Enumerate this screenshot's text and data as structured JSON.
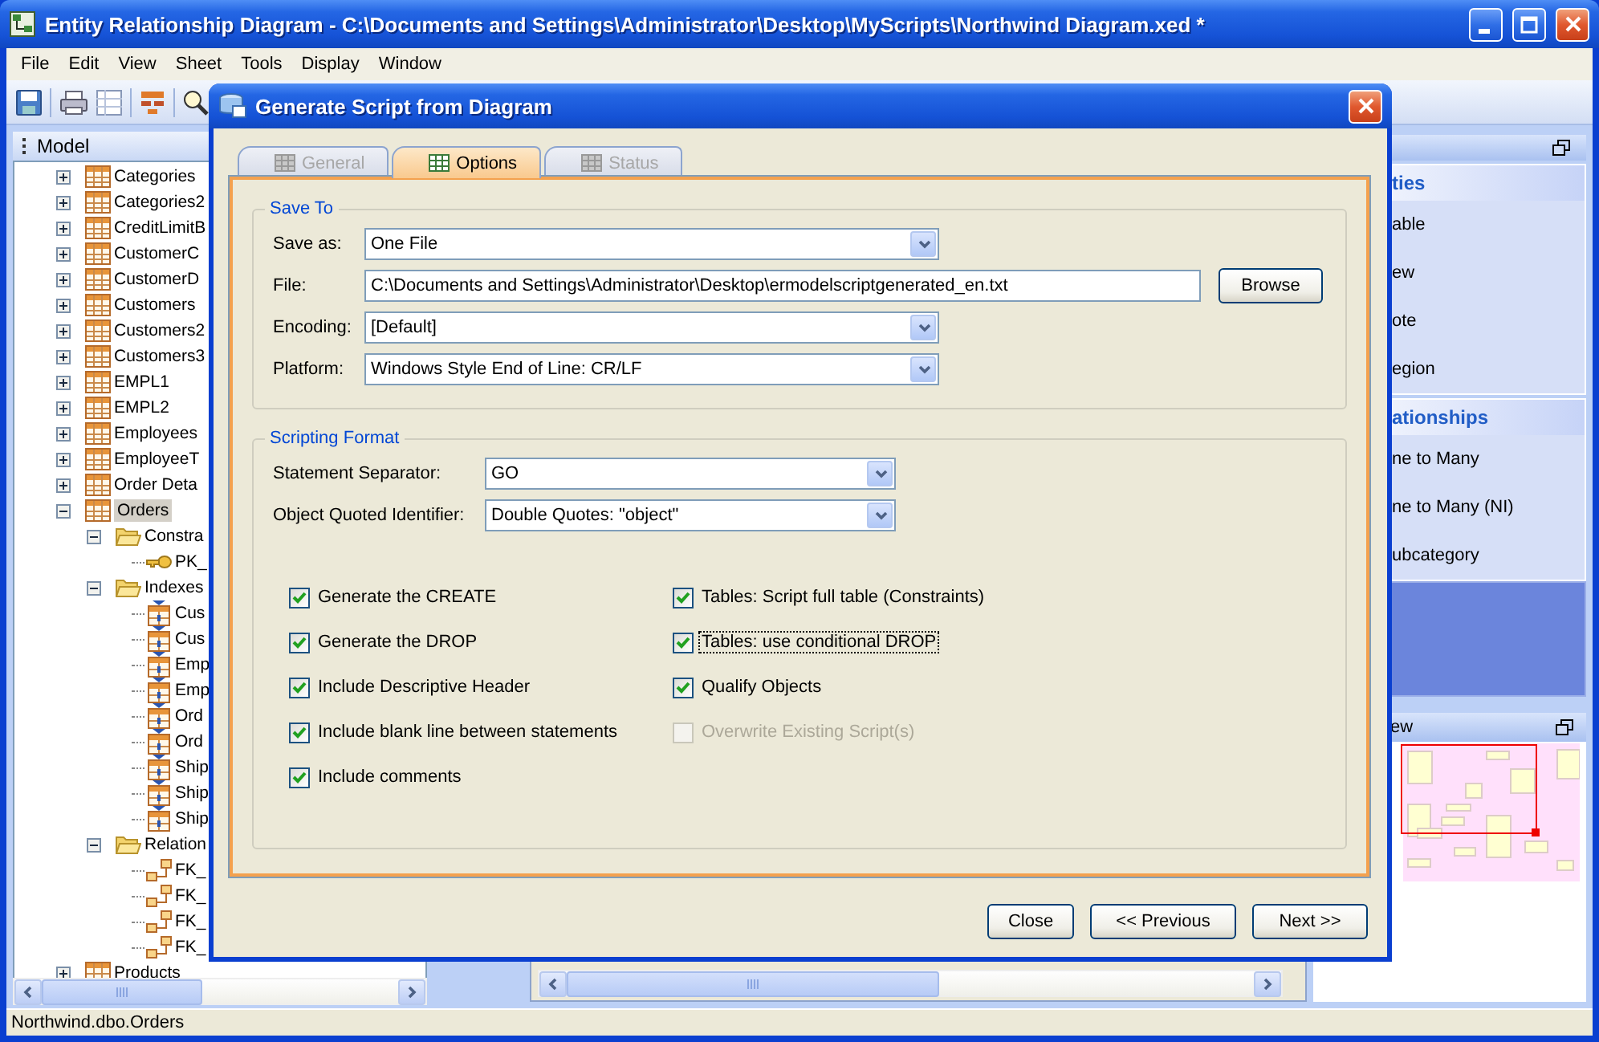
{
  "window": {
    "title": "Entity Relationship Diagram - C:\\Documents and Settings\\Administrator\\Desktop\\MyScripts\\Northwind Diagram.xed *"
  },
  "menu": [
    "File",
    "Edit",
    "View",
    "Sheet",
    "Tools",
    "Display",
    "Window"
  ],
  "model": {
    "title": "Model",
    "tree": [
      {
        "label": "Categories",
        "kind": "table",
        "expanded": false,
        "selected": false
      },
      {
        "label": "Categories2",
        "kind": "table",
        "expanded": false,
        "selected": false
      },
      {
        "label": "CreditLimitB",
        "kind": "table",
        "expanded": false,
        "selected": false
      },
      {
        "label": "CustomerC",
        "kind": "table",
        "expanded": false,
        "selected": false
      },
      {
        "label": "CustomerD",
        "kind": "table",
        "expanded": false,
        "selected": false
      },
      {
        "label": "Customers",
        "kind": "table",
        "expanded": false,
        "selected": false
      },
      {
        "label": "Customers2",
        "kind": "table",
        "expanded": false,
        "selected": false
      },
      {
        "label": "Customers3",
        "kind": "table",
        "expanded": false,
        "selected": false
      },
      {
        "label": "EMPL1",
        "kind": "table",
        "expanded": false,
        "selected": false
      },
      {
        "label": "EMPL2",
        "kind": "table",
        "expanded": false,
        "selected": false
      },
      {
        "label": "Employees",
        "kind": "table",
        "expanded": false,
        "selected": false
      },
      {
        "label": "EmployeeT",
        "kind": "table",
        "expanded": false,
        "selected": false
      },
      {
        "label": "Order Deta",
        "kind": "table",
        "expanded": false,
        "selected": false
      },
      {
        "label": "Orders",
        "kind": "table",
        "expanded": true,
        "selected": true,
        "children": [
          {
            "label": "Constra",
            "kind": "folder",
            "expanded": true,
            "selected": false,
            "children": [
              {
                "label": "PK_",
                "kind": "key",
                "selected": false
              }
            ]
          },
          {
            "label": "Indexes",
            "kind": "folder",
            "expanded": true,
            "selected": false,
            "children": [
              {
                "label": "Cus",
                "kind": "index",
                "selected": false
              },
              {
                "label": "Cus",
                "kind": "index",
                "selected": false
              },
              {
                "label": "Emp",
                "kind": "index",
                "selected": false
              },
              {
                "label": "Emp",
                "kind": "index",
                "selected": false
              },
              {
                "label": "Ord",
                "kind": "index",
                "selected": false
              },
              {
                "label": "Ord",
                "kind": "index",
                "selected": false
              },
              {
                "label": "Ship",
                "kind": "index",
                "selected": false
              },
              {
                "label": "Ship",
                "kind": "index",
                "selected": false
              },
              {
                "label": "Ship",
                "kind": "index",
                "selected": false
              }
            ]
          },
          {
            "label": "Relation",
            "kind": "folder",
            "expanded": true,
            "selected": false,
            "children": [
              {
                "label": "FK_",
                "kind": "relation",
                "selected": false
              },
              {
                "label": "FK_",
                "kind": "relation",
                "selected": false
              },
              {
                "label": "FK_",
                "kind": "relation",
                "selected": false
              },
              {
                "label": "FK_",
                "kind": "relation",
                "selected": false
              }
            ]
          }
        ]
      },
      {
        "label": "Products",
        "kind": "table",
        "expanded": false,
        "selected": false
      }
    ]
  },
  "palette": {
    "sections": [
      {
        "title": "ties",
        "items": [
          "able",
          "ew",
          "ote",
          "egion"
        ]
      },
      {
        "title": "ationships",
        "items": [
          "ne to Many",
          "ne to Many (NI)",
          "ubcategory"
        ]
      }
    ]
  },
  "overview": {
    "title": "ew"
  },
  "status_bar": "Northwind.dbo.Orders",
  "dialog": {
    "title": "Generate Script from Diagram",
    "tabs": [
      {
        "label": "General",
        "selected": false,
        "disabled": true
      },
      {
        "label": "Options",
        "selected": true,
        "disabled": false
      },
      {
        "label": "Status",
        "selected": false,
        "disabled": true
      }
    ],
    "save_to": {
      "title": "Save To",
      "fields": [
        {
          "label": "Save as:",
          "kind": "select",
          "value": "One File"
        },
        {
          "label": "File:",
          "kind": "file",
          "value": "C:\\Documents and Settings\\Administrator\\Desktop\\ermodelscriptgenerated_en.txt",
          "button": "Browse"
        },
        {
          "label": "Encoding:",
          "kind": "select",
          "value": "[Default]"
        },
        {
          "label": "Platform:",
          "kind": "select",
          "value": "Windows Style End of Line: CR/LF"
        }
      ]
    },
    "scripting_format": {
      "title": "Scripting Format",
      "fields": [
        {
          "label": "Statement Separator:",
          "kind": "select",
          "value": "GO"
        },
        {
          "label": "Object Quoted Identifier:",
          "kind": "select",
          "value": "Double Quotes: \"object\""
        }
      ],
      "options_left": [
        {
          "label": "Generate the CREATE",
          "checked": true,
          "disabled": false,
          "focused": false
        },
        {
          "label": "Generate the DROP",
          "checked": true,
          "disabled": false,
          "focused": false
        },
        {
          "label": "Include Descriptive Header",
          "checked": true,
          "disabled": false,
          "focused": false
        },
        {
          "label": "Include blank line between statements",
          "checked": true,
          "disabled": false,
          "focused": false
        },
        {
          "label": "Include comments",
          "checked": true,
          "disabled": false,
          "focused": false
        }
      ],
      "options_right": [
        {
          "label": "Tables: Script full table (Constraints)",
          "checked": true,
          "disabled": false,
          "focused": false
        },
        {
          "label": "Tables: use conditional DROP",
          "checked": true,
          "disabled": false,
          "focused": true
        },
        {
          "label": "Qualify Objects",
          "checked": true,
          "disabled": false,
          "focused": false
        },
        {
          "label": "Overwrite Existing Script(s)",
          "checked": false,
          "disabled": true,
          "focused": false
        }
      ]
    },
    "buttons": [
      "Close",
      "<< Previous",
      "Next >>"
    ]
  }
}
